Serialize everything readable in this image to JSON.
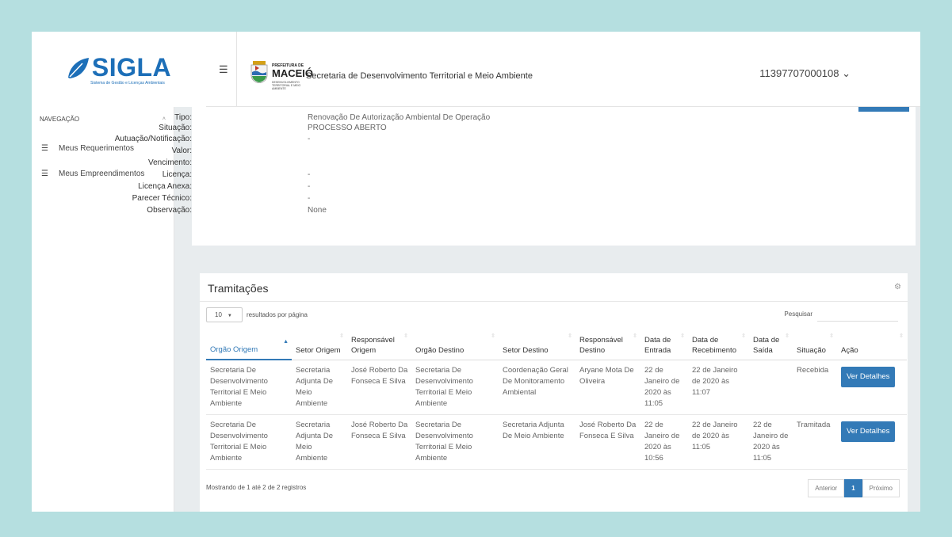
{
  "app": {
    "logo_text": "SIGLA",
    "logo_subtitle": "Sistema de Gestão e Licenças Ambientais",
    "brand_color": "#1d6fb8"
  },
  "header": {
    "menu_icon": "hamburger-icon",
    "prefeitura_label": "PREFEITURA DE",
    "city": "MACEIÓ",
    "crest_subtitle": "DESENVOLVIMENTO TERRITORIAL E MEIO AMBIENTE",
    "title": "Secretaria de Desenvolvimento Territorial e Meio Ambiente",
    "user": "11397707000108 ⌄"
  },
  "sidebar": {
    "heading": "NAVEGAÇÃO",
    "caret": "˄",
    "items": [
      {
        "label": "Meus Requerimentos",
        "icon": "list-icon"
      },
      {
        "label": "Meus Empreendimentos",
        "icon": "list-icon"
      }
    ]
  },
  "details": {
    "rows": [
      {
        "label": "Tipo:",
        "value": "Renovação De Autorização Ambiental De Operação"
      },
      {
        "label": "Situação:",
        "value": "PROCESSO ABERTO"
      },
      {
        "label": "Autuação/Notificação:",
        "value": "-"
      },
      {
        "label": "Valor:",
        "value": ""
      },
      {
        "label": "Vencimento:",
        "value": ""
      },
      {
        "label": "Licença:",
        "value": "-"
      },
      {
        "label": "Licença Anexa:",
        "value": "-"
      },
      {
        "label": "Parecer Técnico:",
        "value": "-"
      },
      {
        "label": "Observação:",
        "value": "None"
      }
    ]
  },
  "tramitacoes": {
    "title": "Tramitações",
    "length_value": "10",
    "length_suffix": "resultados por página",
    "search_label": "Pesquisar",
    "columns": [
      "Orgão Origem",
      "Setor Origem",
      "Responsável Origem",
      "Orgão Destino",
      "Setor Destino",
      "Responsável Destino",
      "Data de Entrada",
      "Data de Recebimento",
      "Data de Saída",
      "Situação",
      "Ação"
    ],
    "rows": [
      [
        "Secretaria De Desenvolvimento Territorial E Meio Ambiente",
        "Secretaria Adjunta De Meio Ambiente",
        "José Roberto Da Fonseca E Silva",
        "Secretaria De Desenvolvimento Territorial E Meio Ambiente",
        "Coordenação Geral De Monitoramento Ambiental",
        "Aryane Mota De Oliveira",
        "22 de Janeiro de 2020 às 11:05",
        "22 de Janeiro de 2020 às 11:07",
        "",
        "Recebida",
        "Ver Detalhes"
      ],
      [
        "Secretaria De Desenvolvimento Territorial E Meio Ambiente",
        "Secretaria Adjunta De Meio Ambiente",
        "José Roberto Da Fonseca E Silva",
        "Secretaria De Desenvolvimento Territorial E Meio Ambiente",
        "Secretaria Adjunta De Meio Ambiente",
        "José Roberto Da Fonseca E Silva",
        "22 de Janeiro de 2020 às 10:56",
        "22 de Janeiro de 2020 às 11:05",
        "22 de Janeiro de 2020 às 11:05",
        "Tramitada",
        "Ver Detalhes"
      ]
    ],
    "info": "Mostrando de 1 até 2 de 2 registros",
    "pager": {
      "prev": "Anterior",
      "page": "1",
      "next": "Próximo"
    }
  }
}
